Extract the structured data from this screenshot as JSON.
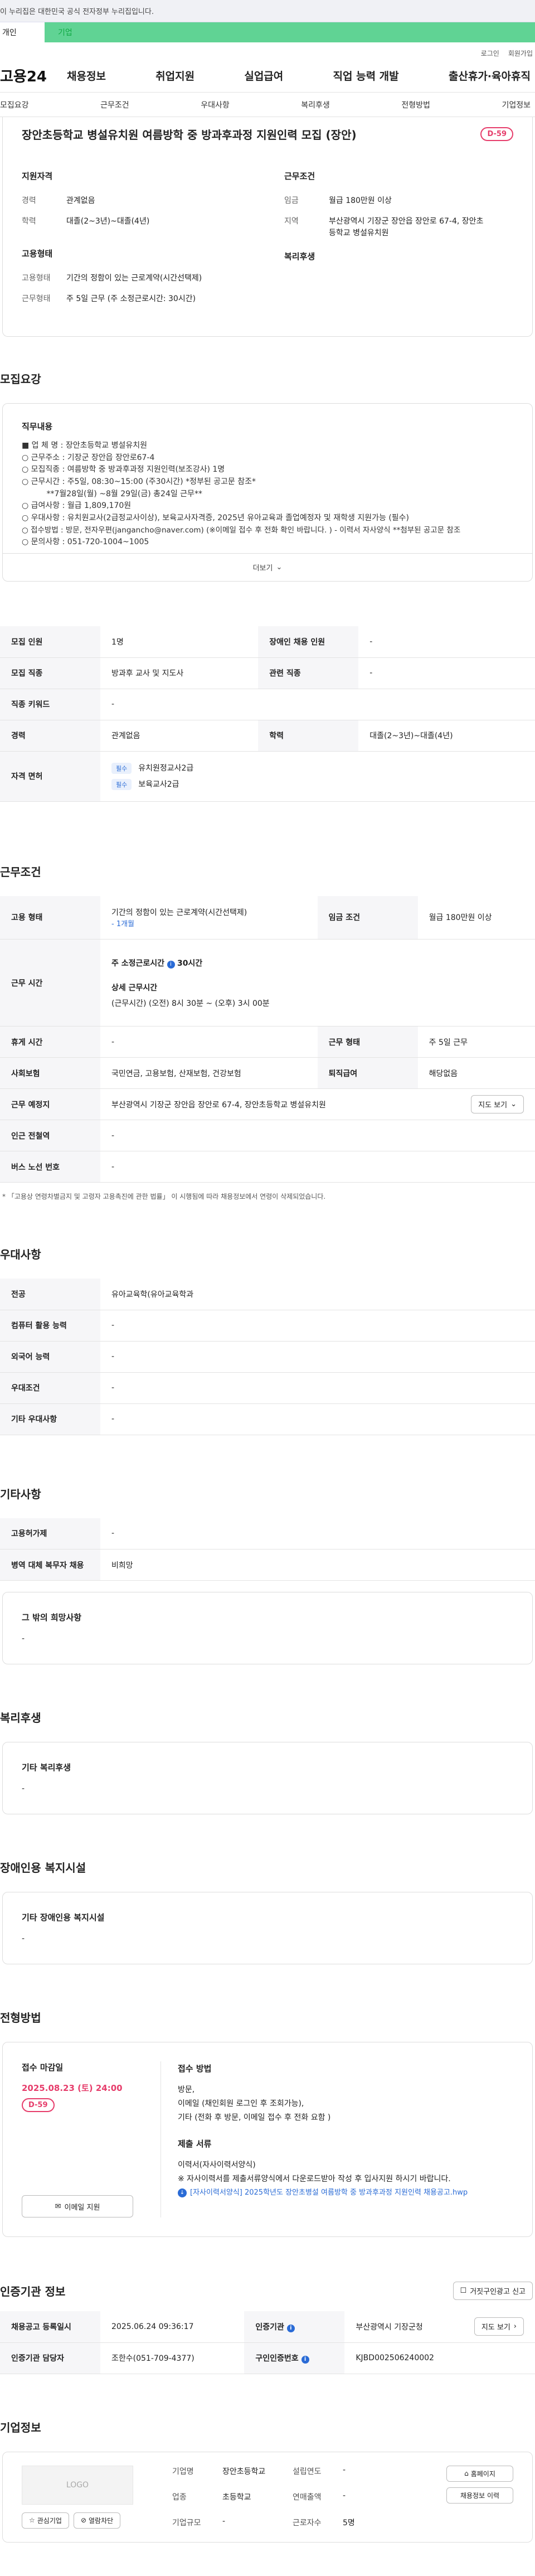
{
  "topbar": {
    "notice": "이 누리집은 대한민국 공식 전자정부 누리집입니다."
  },
  "usertabs": {
    "personal": "개인",
    "company": "기업"
  },
  "util": {
    "login": "로그인",
    "signup": "회원가입"
  },
  "gnb": {
    "logo": "고용24",
    "menu": [
      "채용정보",
      "취업지원",
      "실업급여",
      "직업 능력 개발",
      "출산휴가·육아휴직"
    ]
  },
  "subnav": [
    "모집요강",
    "근무조건",
    "우대사항",
    "복리후생",
    "전형방법",
    "기업정보"
  ],
  "job": {
    "title": "장안초등학교 병설유치원 여름방학 중 방과후과정 지원인력 모집 (장안)",
    "dday": "D-59",
    "qualification_h": "지원자격",
    "career_k": "경력",
    "career_v": "관계없음",
    "edu_k": "학력",
    "edu_v": "대졸(2~3년)~대졸(4년)",
    "condition_h": "근무조건",
    "wage_k": "임금",
    "wage_v": "월급 180만원 이상",
    "area_k": "지역",
    "area_v": "부산광역시 기장군 장안읍 장안로 67-4, 장안초등학교 병설유치원",
    "employment_h": "고용형태",
    "emp_type_k": "고용형태",
    "emp_type_v": "기간의 정함이 있는 근로계약(시간선택제)",
    "work_k": "근무형태",
    "work_v": "주 5일 근무 (주 소정근로시간: 30시간)",
    "welfare_h": "복리후생"
  },
  "recruit": {
    "section": "모집요강",
    "duty_h": "직무내용",
    "lines": [
      "■ 업 체 명 : 장안초등학교 병설유치원",
      "○ 근무주소 : 기장군 장안읍 장안로67-4",
      "○ 모집직종 : 여름방학 중 방과후과정 지원인력(보조강사)  1명",
      "○ 근무시간 : 주5일, 08:30~15:00  (주30시간)    *정부된 공고문 참조*",
      "          **7월28일(월) ~8월 29일(금) 총24일 근무**",
      "○ 급여사항 : 월급 1,809,170원",
      "○ 우대사항 : 유치원교사(2급정교사이상), 보육교사자격증,  2025년 유아교육과 졸업예정자 및 재학생 지원가능 (필수)",
      "○ 접수방법 : 방문, 전자우편(janganchо@naver.com) (※이메일 접수 후 전화 확인 바랍니다. ) - 이력서 자사양식  **첨부된 공고문 참조",
      "○ 문의사항 : 051-720-1004~1005"
    ],
    "more": "더보기"
  },
  "recruit_table": {
    "count_k": "모집 인원",
    "count_v": "1명",
    "disabled_k": "장애인 채용 인원",
    "disabled_v": "-",
    "job_k": "모집 직종",
    "job_v": "방과후 교사 및 지도사",
    "related_k": "관련 직종",
    "related_v": "-",
    "keyword_k": "직종 키워드",
    "keyword_v": "-",
    "career_k": "경력",
    "career_v": "관계없음",
    "edu_k": "학력",
    "edu_v": "대졸(2~3년)~대졸(4년)",
    "license_k": "자격 면허",
    "license_tag": "필수",
    "licenses": [
      "유치원정교사2급",
      "보육교사2급"
    ]
  },
  "conditions": {
    "section": "근무조건",
    "emp_k": "고용 형태",
    "emp_v": "기간의 정함이 있는 근로계약(시간선택제)",
    "emp_sub": "- 1개월",
    "wage_k": "임금 조건",
    "wage_v": "월급 180만원 이상",
    "time_k": "근무 시간",
    "weekly_label": "주 소정근로시간",
    "weekly_v": "30시간",
    "detail_label": "상세 근무시간",
    "detail_v": "(근무시간) (오전) 8시 30분 ~ (오후) 3시 00분",
    "rest_k": "휴게 시간",
    "rest_v": "-",
    "form_k": "근무 형태",
    "form_v": "주 5일 근무",
    "ins_k": "사회보험",
    "ins_v": "국민연금, 고용보험, 산재보험, 건강보험",
    "retire_k": "퇴직급여",
    "retire_v": "해당없음",
    "place_k": "근무 예정지",
    "place_v": "부산광역시 기장군 장안읍 장안로 67-4, 장안초등학교 병설유치원",
    "map_btn": "지도 보기",
    "subway_k": "인근 전철역",
    "subway_v": "-",
    "bus_k": "버스 노선 번호",
    "bus_v": "-",
    "note": "* 「고용상 연령차별금지 및 고령자 고용촉진에 관한 법률」 이 시행됨에 따라 채용정보에서 연령이 삭제되었습니다."
  },
  "preference": {
    "section": "우대사항",
    "major_k": "전공",
    "major_v": "유아교육학(유아교육학과",
    "computer_k": "컴퓨터 활용 능력",
    "computer_v": "-",
    "lang_k": "외국어 능력",
    "lang_v": "-",
    "pref_k": "우대조건",
    "pref_v": "-",
    "etc_k": "기타 우대사항",
    "etc_v": "-"
  },
  "etc": {
    "section": "기타사항",
    "hire_k": "고용허가제",
    "hire_v": "-",
    "military_k": "병역 대체 복무자 채용",
    "military_v": "비희망",
    "other_h": "그 밖의 희망사항",
    "other_v": "-"
  },
  "welfare": {
    "section": "복리후생",
    "h": "기타 복리후생",
    "v": "-"
  },
  "disabled": {
    "section": "장애인용 복지시설",
    "h": "기타 장애인용 복지시설",
    "v": "-"
  },
  "apply": {
    "section": "전형방법",
    "deadline_h": "접수 마감일",
    "deadline_v": "2025.08.23 (토) 24:00",
    "dday": "D-59",
    "email_btn": "이메일 지원",
    "method_h": "접수 방법",
    "method_lines": [
      "방문,",
      "이메일 (채인회원 로그인 후 조회가능),",
      "기타 (전화 후 방문, 이메일 접수 후 전화 요함 )"
    ],
    "docs_h": "제출 서류",
    "docs_lines": [
      "이력서(자사이력서양식)",
      "※ 자사이력서를 제출서류양식에서 다운로드받아 작성 후 입사지원 하시기 바랍니다."
    ],
    "file": "[자사이력서양식] 2025학년도 장안초병설 여름방학 중 방과후과정 지원인력 채용공고.hwp"
  },
  "agency": {
    "section": "인증기관 정보",
    "report_btn": "거짓구인광고 신고",
    "date_k": "채용공고 등록일시",
    "date_v": "2025.06.24 09:36:17",
    "org_k": "인증기관",
    "org_v": "부산광역시 기장군청",
    "map_btn": "지도 보기",
    "manager_k": "인증기관 담당자",
    "manager_v": "조한수(051-709-4377)",
    "no_k": "구인인증번호",
    "no_v": "KJBD002506240002"
  },
  "company": {
    "section": "기업정보",
    "logo": "LOGO",
    "fav_btn": "관심기업",
    "block_btn": "열람차단",
    "name_k": "기업명",
    "name_v": "장안초등학교",
    "industry_k": "업종",
    "industry_v": "초등학교",
    "size_k": "기업규모",
    "size_v": "-",
    "year_k": "설립연도",
    "year_v": "-",
    "revenue_k": "연매출액",
    "revenue_v": "-",
    "staff_k": "근로자수",
    "staff_v": "5명",
    "home_btn": "홈페이지",
    "list_btn": "채용정보 이력"
  }
}
